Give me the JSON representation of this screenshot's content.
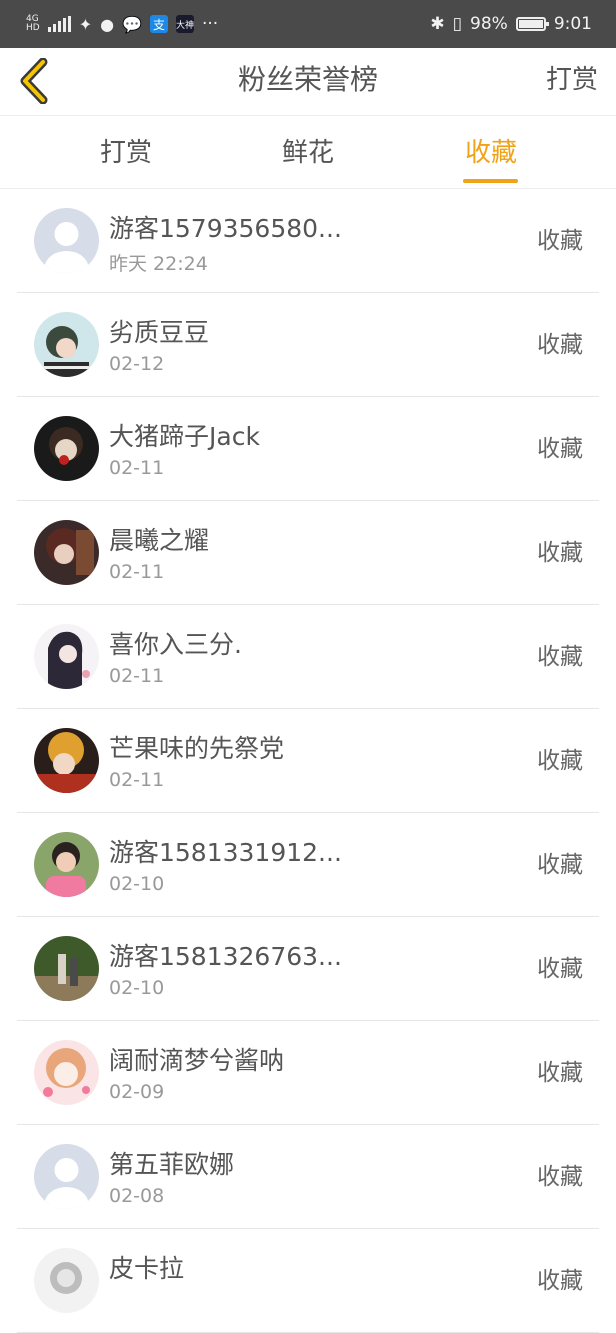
{
  "status_bar": {
    "network_top": "4G",
    "network_bottom": "HD",
    "app_text": "大神",
    "dots": "···",
    "battery": "98%",
    "time": "9:01"
  },
  "header": {
    "title": "粉丝荣誉榜",
    "action": "打赏"
  },
  "tabs": [
    {
      "label": "打赏",
      "active": false
    },
    {
      "label": "鲜花",
      "active": false
    },
    {
      "label": "收藏",
      "active": true
    }
  ],
  "colors": {
    "accent": "#f0a318",
    "status_bar": "#4a4a4a"
  },
  "list": [
    {
      "name": "游客1579356580...",
      "date": "昨天 22:24",
      "action": "收藏",
      "avatar": "default-avatar"
    },
    {
      "name": "劣质豆豆",
      "date": "02-12",
      "action": "收藏",
      "avatar": "photo-avatar"
    },
    {
      "name": "大猪蹄子Jack",
      "date": "02-11",
      "action": "收藏",
      "avatar": "photo-avatar"
    },
    {
      "name": "晨曦之耀",
      "date": "02-11",
      "action": "收藏",
      "avatar": "photo-avatar"
    },
    {
      "name": "喜你入三分.",
      "date": "02-11",
      "action": "收藏",
      "avatar": "photo-avatar"
    },
    {
      "name": "芒果味的先祭党",
      "date": "02-11",
      "action": "收藏",
      "avatar": "photo-avatar"
    },
    {
      "name": "游客1581331912...",
      "date": "02-10",
      "action": "收藏",
      "avatar": "photo-avatar"
    },
    {
      "name": "游客1581326763...",
      "date": "02-10",
      "action": "收藏",
      "avatar": "photo-avatar"
    },
    {
      "name": "阔耐滴梦兮酱呐",
      "date": "02-09",
      "action": "收藏",
      "avatar": "photo-avatar"
    },
    {
      "name": "第五菲欧娜",
      "date": "02-08",
      "action": "收藏",
      "avatar": "default-avatar"
    },
    {
      "name": "皮卡拉",
      "date": "",
      "action": "收藏",
      "avatar": "photo-avatar"
    }
  ]
}
